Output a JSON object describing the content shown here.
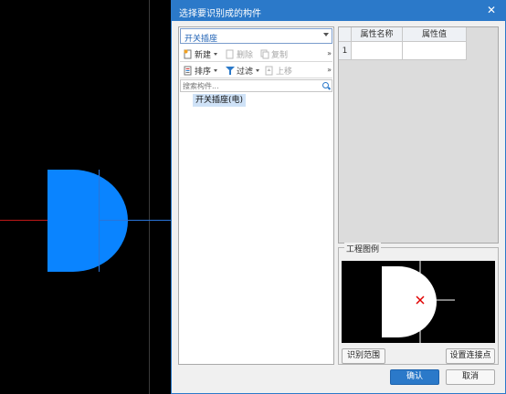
{
  "dialog": {
    "title": "选择要识别成的构件",
    "close_glyph": "✕"
  },
  "component_combo": {
    "value": "开关插座"
  },
  "toolbar1": {
    "new_label": "新建",
    "delete_label": "删除",
    "copy_label": "复制"
  },
  "toolbar2": {
    "sort_label": "排序",
    "filter_label": "过滤",
    "move_up_label": "上移"
  },
  "more_glyph": "»",
  "search": {
    "placeholder": "搜索构件..."
  },
  "tree": {
    "items": [
      {
        "label": "开关插座(电)"
      }
    ]
  },
  "property_grid": {
    "columns": [
      "属性名称",
      "属性值"
    ],
    "rows": [
      {
        "num": "1",
        "name": "",
        "value": ""
      }
    ]
  },
  "preview": {
    "legend": "工程图例"
  },
  "buttons": {
    "identify_range": "识别范围",
    "set_connection_point": "设置连接点",
    "confirm": "确认",
    "cancel": "取消"
  },
  "colors": {
    "accent": "#2b79c9",
    "symbol_fill": "#0a84ff",
    "crosshair_red": "#c01818",
    "crosshair_blue": "#2a74d8"
  },
  "icons": [
    "close-icon",
    "new-icon",
    "delete-icon",
    "copy-icon",
    "sort-icon",
    "filter-icon",
    "move-up-icon",
    "search-icon",
    "dropdown-arrow-icon"
  ]
}
